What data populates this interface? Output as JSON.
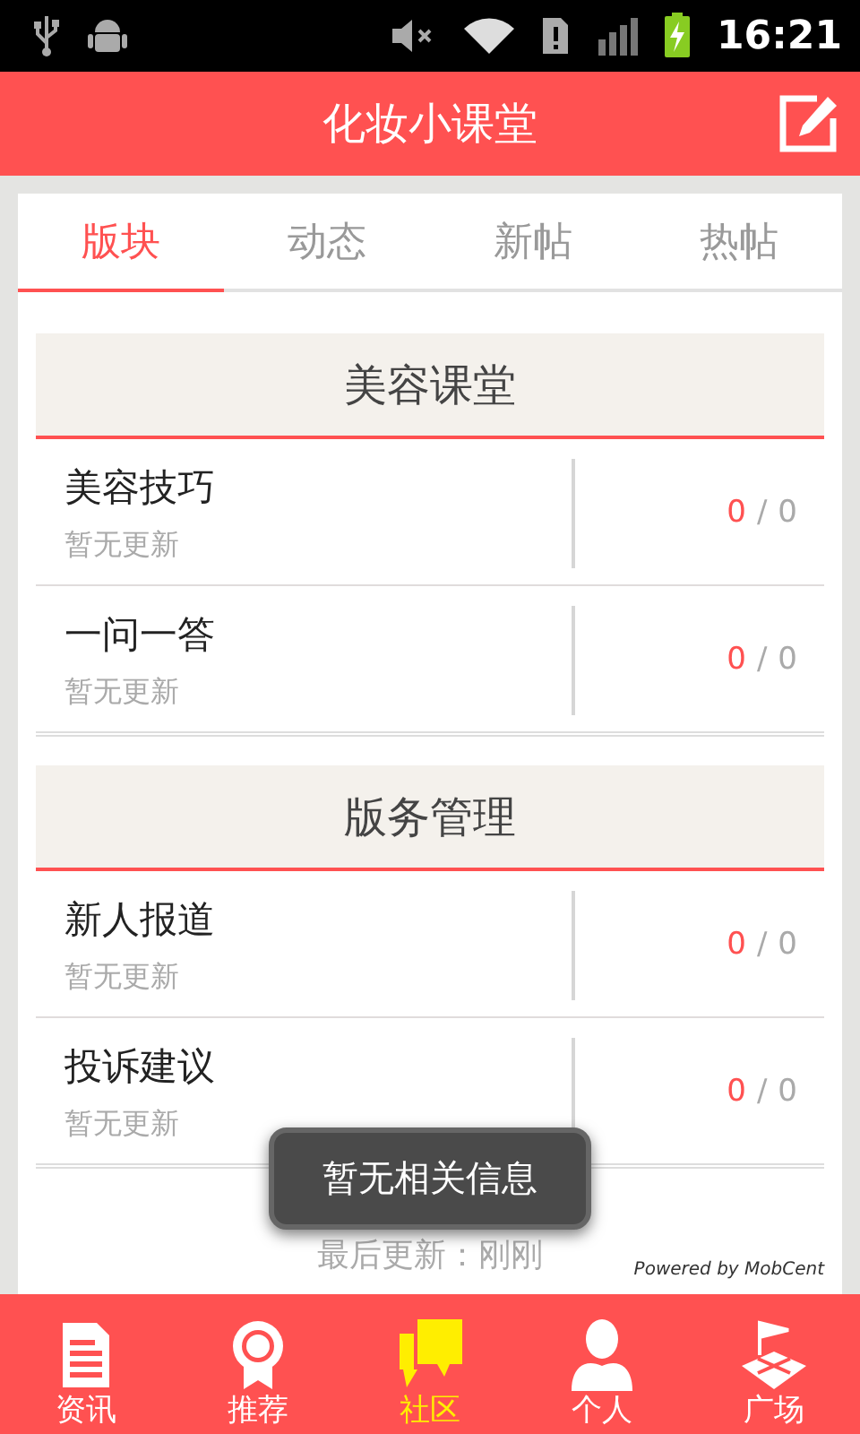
{
  "status_bar": {
    "time": "16:21"
  },
  "header": {
    "title": "化妆小课堂"
  },
  "tabs": [
    {
      "label": "版块",
      "selected": true
    },
    {
      "label": "动态",
      "selected": false
    },
    {
      "label": "新帖",
      "selected": false
    },
    {
      "label": "热帖",
      "selected": false
    }
  ],
  "sections": [
    {
      "title": "美容课堂",
      "boards": [
        {
          "name": "美容技巧",
          "subtitle": "暂无更新",
          "new_count": "0",
          "separator": "/",
          "total": "0"
        },
        {
          "name": "一问一答",
          "subtitle": "暂无更新",
          "new_count": "0",
          "separator": "/",
          "total": "0"
        }
      ]
    },
    {
      "title": "版务管理",
      "boards": [
        {
          "name": "新人报道",
          "subtitle": "暂无更新",
          "new_count": "0",
          "separator": "/",
          "total": "0"
        },
        {
          "name": "投诉建议",
          "subtitle": "暂无更新",
          "new_count": "0",
          "separator": "/",
          "total": "0"
        }
      ]
    }
  ],
  "footer": {
    "last_update": "最后更新：刚刚",
    "powered_by": "Powered by MobCent"
  },
  "toast": "暂无相关信息",
  "bottom_nav": [
    {
      "label": "资讯",
      "selected": false
    },
    {
      "label": "推荐",
      "selected": false
    },
    {
      "label": "社区",
      "selected": true
    },
    {
      "label": "个人",
      "selected": false
    },
    {
      "label": "广场",
      "selected": false
    }
  ]
}
